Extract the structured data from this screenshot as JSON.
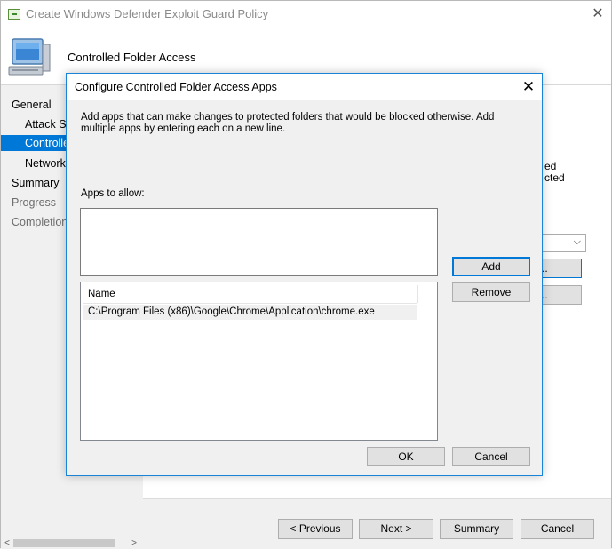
{
  "wizard": {
    "title": "Create Windows Defender Exploit Guard Policy",
    "header_title": "Controlled Folder Access",
    "nav": [
      {
        "label": "General",
        "state": "normal"
      },
      {
        "label": "Attack Su",
        "state": "normal"
      },
      {
        "label": "Controlle",
        "state": "selected"
      },
      {
        "label": "Network",
        "state": "normal"
      },
      {
        "label": "Summary",
        "state": "normal"
      },
      {
        "label": "Progress",
        "state": "disabled"
      },
      {
        "label": "Completion",
        "state": "disabled"
      }
    ],
    "partial_content": [
      "ed",
      "cted"
    ],
    "buttons": {
      "previous": "< Previous",
      "next": "Next >",
      "summary": "Summary",
      "cancel": "Cancel"
    },
    "bg_button_dots": [
      "..",
      ".."
    ]
  },
  "dialog": {
    "title": "Configure Controlled Folder Access Apps",
    "description": "Add apps that can make changes to protected folders that would be blocked otherwise. Add multiple apps by entering each on a new line.",
    "apps_label": "Apps to allow:",
    "input_value": "",
    "list": {
      "column_header": "Name",
      "rows": [
        "C:\\Program Files (x86)\\Google\\Chrome\\Application\\chrome.exe"
      ]
    },
    "buttons": {
      "add": "Add",
      "remove": "Remove",
      "ok": "OK",
      "cancel": "Cancel"
    }
  },
  "colors": {
    "selection": "#0078d7",
    "dialog_border": "#1883d7"
  }
}
